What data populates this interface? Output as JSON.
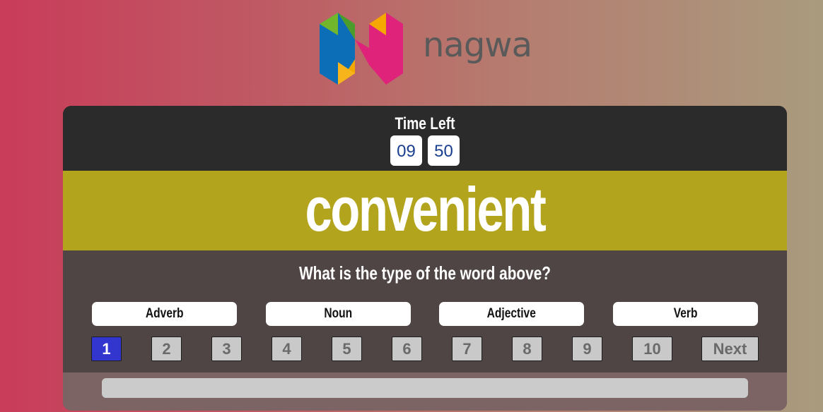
{
  "brand": {
    "name": "nagwa"
  },
  "timer": {
    "title": "Time Left",
    "minutes": "09",
    "seconds": "50"
  },
  "question": {
    "word": "convenient",
    "prompt": "What is the type of the word above?"
  },
  "options": [
    "Adverb",
    "Noun",
    "Adjective",
    "Verb"
  ],
  "pagination": {
    "pages": [
      "1",
      "2",
      "3",
      "4",
      "5",
      "6",
      "7",
      "8",
      "9",
      "10"
    ],
    "current": 1,
    "next_label": "Next"
  },
  "progress": {
    "fraction": 0
  },
  "colors": {
    "timer_band": "#2b2b2b",
    "word_band": "#b3a41d",
    "card": "#4f4545",
    "active_page": "#3236cf",
    "logo_blue": "#0d6eb8",
    "logo_pink": "#e0237a",
    "logo_green": "#72b62b",
    "logo_orange": "#f5a800"
  }
}
